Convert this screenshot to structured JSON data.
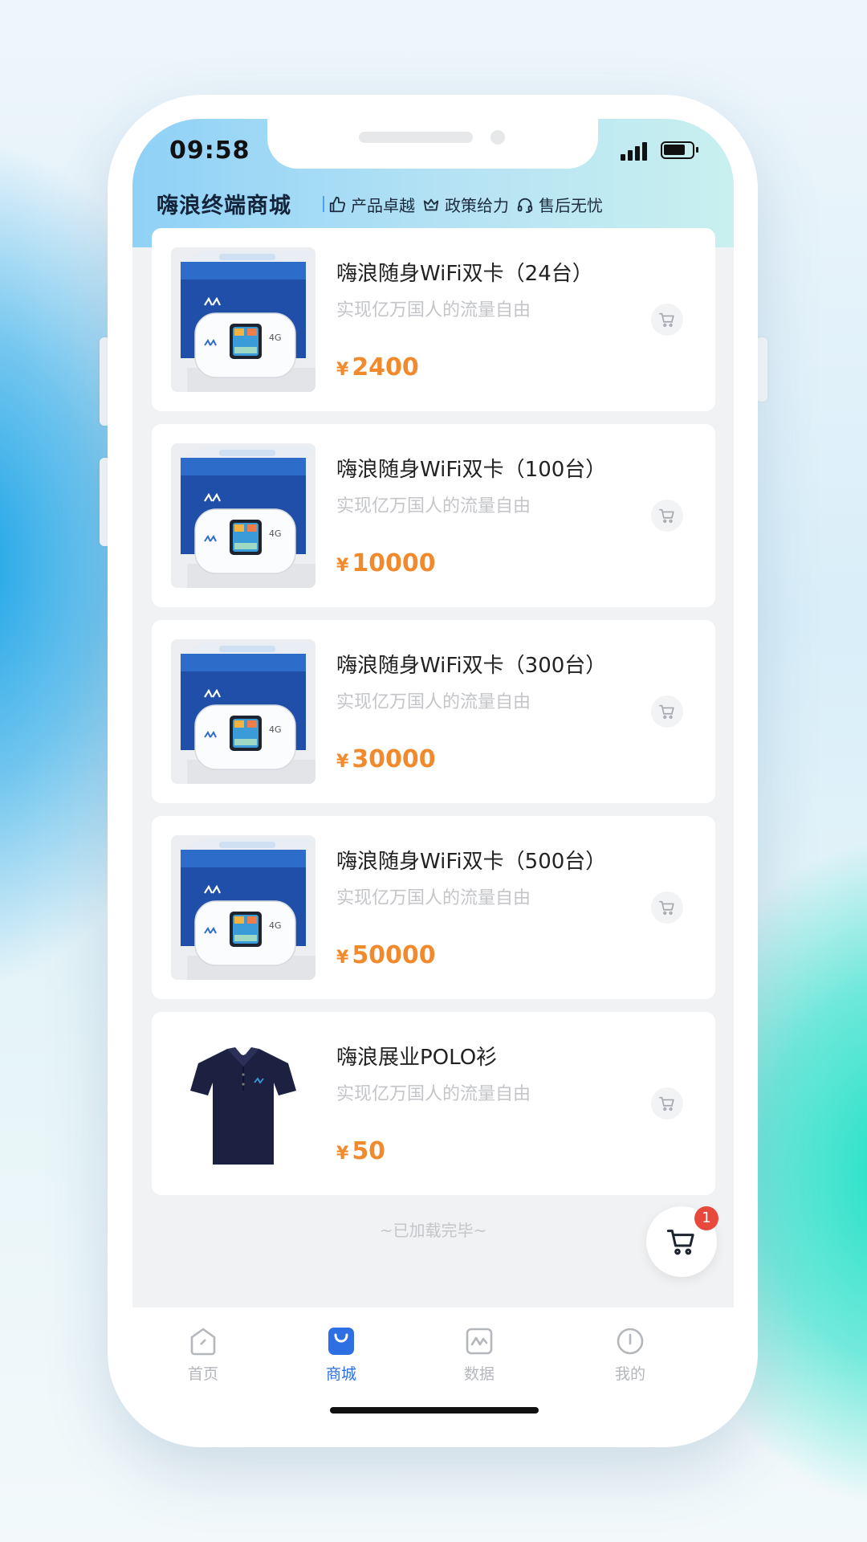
{
  "status_bar": {
    "time": "09:58"
  },
  "header": {
    "title": "嗨浪终端商城",
    "features": [
      "产品卓越",
      "政策给力",
      "售后无忧"
    ]
  },
  "products": [
    {
      "name": "嗨浪随身WiFi双卡（24台）",
      "subtitle": "实现亿万国人的流量自由",
      "currency": "¥",
      "price": "2400",
      "image": "wifi-device"
    },
    {
      "name": "嗨浪随身WiFi双卡（100台）",
      "subtitle": "实现亿万国人的流量自由",
      "currency": "¥",
      "price": "10000",
      "image": "wifi-device"
    },
    {
      "name": "嗨浪随身WiFi双卡（300台）",
      "subtitle": "实现亿万国人的流量自由",
      "currency": "¥",
      "price": "30000",
      "image": "wifi-device"
    },
    {
      "name": "嗨浪随身WiFi双卡（500台）",
      "subtitle": "实现亿万国人的流量自由",
      "currency": "¥",
      "price": "50000",
      "image": "wifi-device"
    },
    {
      "name": "嗨浪展业POLO衫",
      "subtitle": "实现亿万国人的流量自由",
      "currency": "¥",
      "price": "50",
      "image": "polo-shirt"
    }
  ],
  "list_footer": "~已加载完毕~",
  "cart": {
    "badge_count": "1"
  },
  "tabs": [
    {
      "label": "首页",
      "icon": "home-icon",
      "active": false
    },
    {
      "label": "商城",
      "icon": "shopping-bag-icon",
      "active": true
    },
    {
      "label": "数据",
      "icon": "chart-icon",
      "active": false
    },
    {
      "label": "我的",
      "icon": "profile-icon",
      "active": false
    }
  ],
  "colors": {
    "accent": "#2f6fe4",
    "price": "#f08a2c",
    "badge": "#e8493d"
  }
}
